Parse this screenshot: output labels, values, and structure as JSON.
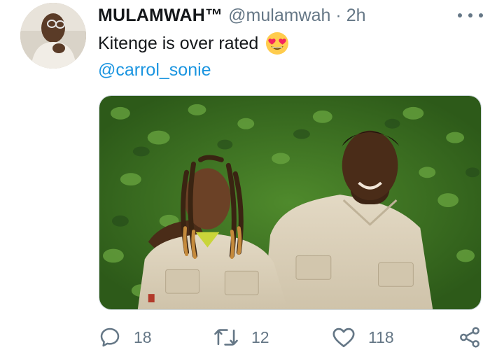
{
  "tweet": {
    "display_name": "MULAMWAH™",
    "handle": "@mulamwah",
    "separator": "·",
    "time": "2h",
    "text": "Kitenge is over rated",
    "emoji": "smiling-face-with-heart-eyes-emoji",
    "mention": "@carrol_sonie"
  },
  "actions": {
    "replies": "18",
    "retweets": "12",
    "likes": "118"
  },
  "icons": {
    "more": "more-horizontal-icon",
    "reply": "reply-icon",
    "retweet": "retweet-icon",
    "like": "heart-icon",
    "share": "share-icon"
  },
  "colors": {
    "text": "#14171a",
    "secondary": "#657786",
    "link": "#1b95e0"
  }
}
